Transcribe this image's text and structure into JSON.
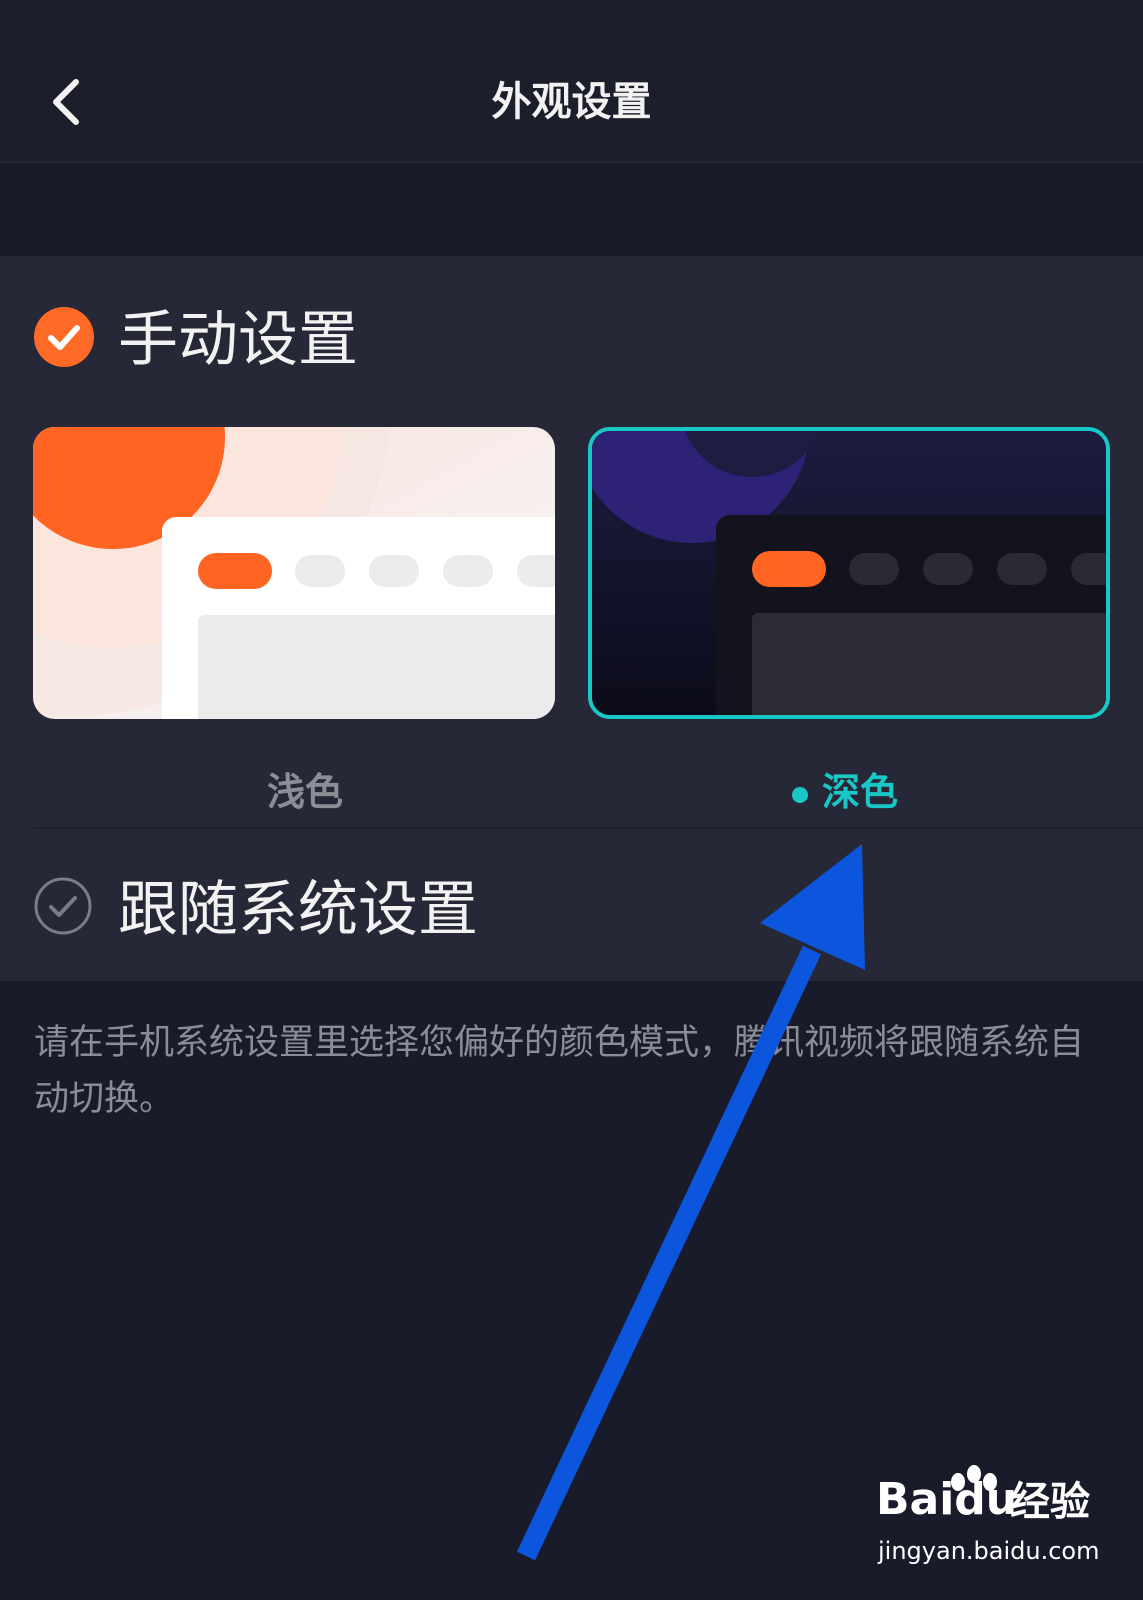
{
  "header": {
    "title": "外观设置",
    "back_icon": "chevron-left-icon"
  },
  "manual": {
    "label": "手动设置",
    "checked": true,
    "check_color": "#ff6a26"
  },
  "themes": {
    "light_label": "浅色",
    "dark_label": "深色",
    "selected": "dark",
    "accent_color": "#19c7c7"
  },
  "follow_system": {
    "label": "跟随系统设置",
    "checked": false
  },
  "description": "请在手机系统设置里选择您偏好的颜色模式，腾讯视频将跟随系统自动切换。",
  "watermark": {
    "brand": "Baidu",
    "suffix": "经验",
    "url": "jingyan.baidu.com"
  }
}
